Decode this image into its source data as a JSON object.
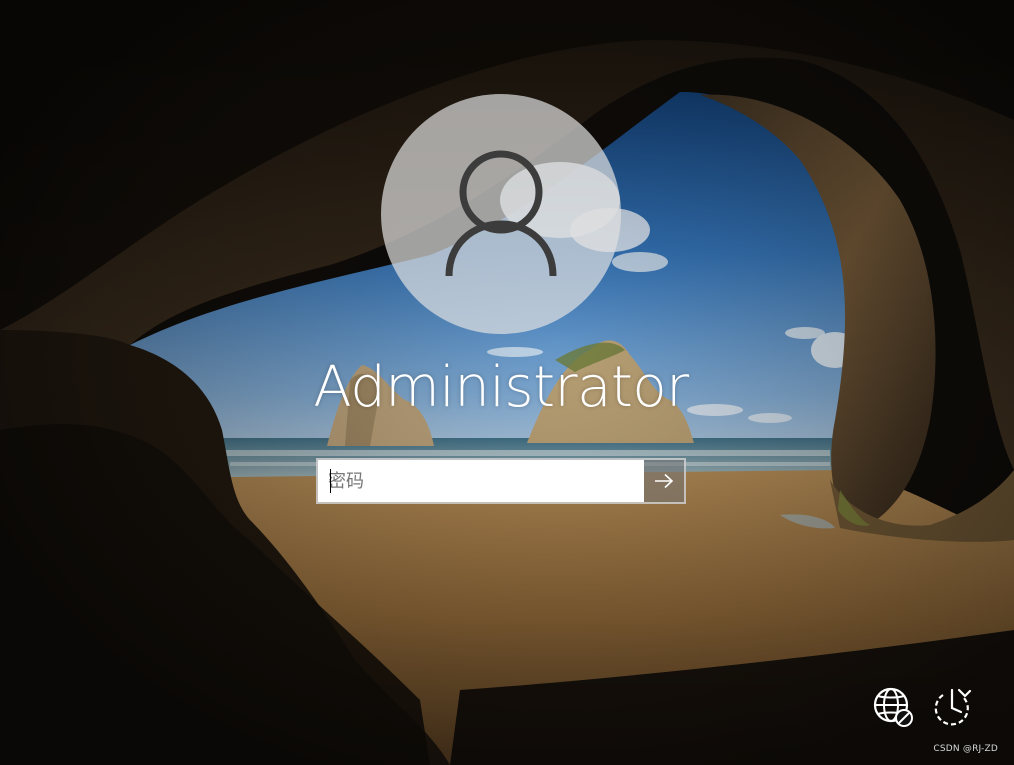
{
  "lock_screen": {
    "user": {
      "name": "Administrator",
      "avatar_icon": "user-silhouette-icon"
    },
    "password": {
      "placeholder": "密码",
      "value": "",
      "submit_icon": "arrow-right-icon"
    },
    "corner_buttons": {
      "network_icon": "network-globe-disconnected-icon",
      "power_icon": "power-restart-icon"
    }
  },
  "watermark": {
    "text": "CSDN @RJ-ZD"
  },
  "colors": {
    "text": "#ffffff",
    "avatar_fill": "#e1e1e1",
    "input_background": "#ffffff",
    "input_border": "#cdcdcd",
    "submit_background": "#6e6e6e"
  }
}
